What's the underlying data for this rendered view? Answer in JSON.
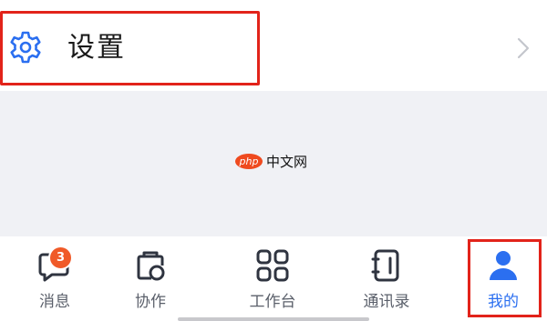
{
  "settings": {
    "label": "设置",
    "icon": "gear-icon"
  },
  "watermark": {
    "logo": "php",
    "text": "中文网"
  },
  "tabbar": {
    "tabs": [
      {
        "label": "消息",
        "icon": "chat-bubble-icon",
        "badge": "3"
      },
      {
        "label": "协作",
        "icon": "collaboration-icon"
      },
      {
        "label": "工作台",
        "icon": "grid-icon"
      },
      {
        "label": "通讯录",
        "icon": "contacts-book-icon"
      },
      {
        "label": "我的",
        "icon": "user-icon",
        "active": true
      }
    ]
  },
  "colors": {
    "accent": "#2b6ff0",
    "highlight": "#e2231a",
    "badge": "#f05a28",
    "tab_text": "#5a5f6a",
    "background": "#f0f1f5"
  }
}
